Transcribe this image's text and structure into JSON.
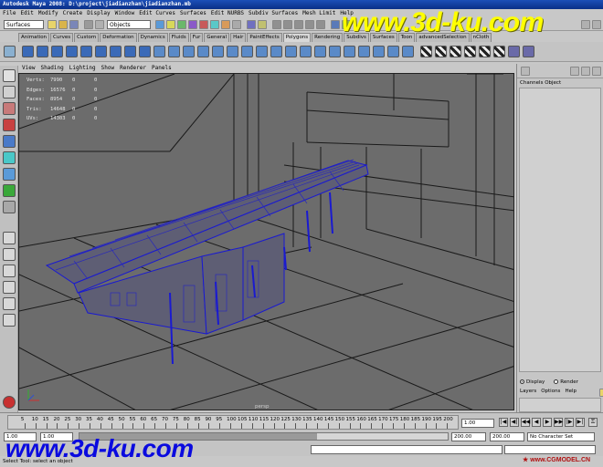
{
  "window": {
    "title": "Autodesk Maya 2008: D:\\project\\jiadianzhan\\jiadianzhan.mb"
  },
  "menu": [
    "File",
    "Edit",
    "Modify",
    "Create",
    "Display",
    "Window",
    "Edit Curves",
    "Surfaces",
    "Edit NURBS",
    "Subdiv Surfaces",
    "Mesh Limit",
    "Help"
  ],
  "status_line": {
    "menu_set": "Surfaces",
    "selection_mode": "Objects"
  },
  "shelf_tabs": [
    "Animation",
    "Curves",
    "Custom",
    "Deformation",
    "Dynamics",
    "Fluids",
    "Fur",
    "General",
    "Hair",
    "PaintEffects",
    "Polygons",
    "Rendering",
    "Subdivs",
    "Surfaces",
    "Toon",
    "advancedSelection",
    "nCloth"
  ],
  "active_shelf_tab": "Polygons",
  "viewport": {
    "menu": [
      "View",
      "Shading",
      "Lighting",
      "Show",
      "Renderer",
      "Panels"
    ],
    "hud": [
      {
        "label": "Verts:",
        "total": "7990",
        "sel1": "0",
        "sel2": "0"
      },
      {
        "label": "Edges:",
        "total": "16576",
        "sel1": "0",
        "sel2": "0"
      },
      {
        "label": "Faces:",
        "total": "8954",
        "sel1": "0",
        "sel2": "0"
      },
      {
        "label": "Tris:",
        "total": "14648",
        "sel1": "0",
        "sel2": "0"
      },
      {
        "label": "UVs:",
        "total": "14303",
        "sel1": "0",
        "sel2": "0"
      }
    ],
    "camera_label": "persp",
    "background_color": "#6c6c6c",
    "wire_color": "#1a1ad0",
    "line_color": "#1a1a1a"
  },
  "channel_box": {
    "menu": [
      "Channels",
      "Object"
    ],
    "display_options": [
      {
        "label": "Display",
        "selected": true
      },
      {
        "label": "Render",
        "selected": false
      }
    ],
    "layers_menu": [
      "Layers",
      "Options",
      "Help"
    ]
  },
  "time_slider": {
    "ticks": [
      "5",
      "10",
      "15",
      "20",
      "25",
      "30",
      "35",
      "40",
      "45",
      "50",
      "55",
      "60",
      "65",
      "70",
      "75",
      "80",
      "85",
      "90",
      "95",
      "100",
      "105",
      "110",
      "115",
      "120",
      "125",
      "130",
      "135",
      "140",
      "145",
      "150",
      "155",
      "160",
      "165",
      "170",
      "175",
      "180",
      "185",
      "190",
      "195",
      "200"
    ],
    "current_frame": "1.00"
  },
  "range": {
    "start": "1.00",
    "range_start": "1.00",
    "range_end": "200.00",
    "end": "200.00",
    "character_set": "No Character Set"
  },
  "help_line": "Select Tool: select an object",
  "watermarks": {
    "top": "www.3d-ku.com",
    "bottom": "www.3d-ku.com",
    "small": "★ www.CGMODEL.CN"
  }
}
